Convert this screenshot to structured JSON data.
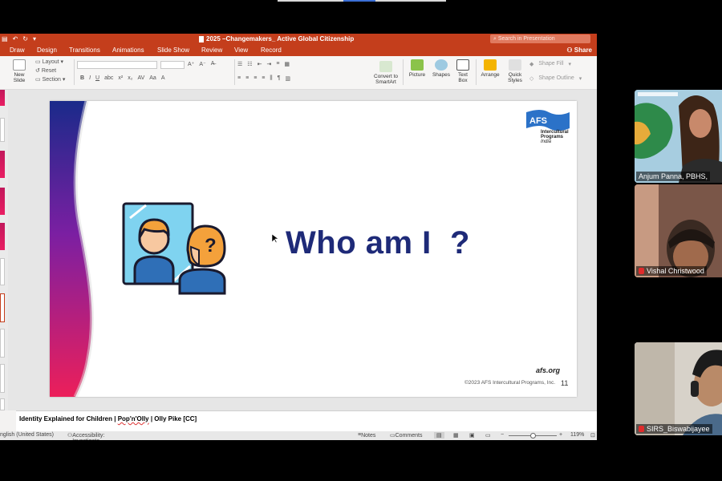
{
  "window": {
    "title": "2025 –Changemakers_ Active Global Citizenship",
    "search_placeholder": "Search in Presentation",
    "share_label": "Share"
  },
  "menu": [
    "Draw",
    "Design",
    "Transitions",
    "Animations",
    "Slide Show",
    "Review",
    "View",
    "Record"
  ],
  "ribbon": {
    "new_slide": "New Slide",
    "layout": "Layout",
    "reset": "Reset",
    "section": "Section",
    "convert": "Convert to SmartArt",
    "picture": "Picture",
    "shapes": "Shapes",
    "text_box": "Text Box",
    "arrange": "Arrange",
    "quick_styles": "Quick Styles",
    "shape_fill": "Shape Fill",
    "shape_outline": "Shape Outline"
  },
  "slide": {
    "heading": "Who am I  ?",
    "logo_brand": "AFS",
    "logo_sub": "Intercultural Programs",
    "logo_country": "India",
    "afs_org": "afs.org",
    "copyright": "©2023 AFS Intercultural Programs, Inc.",
    "number": "11"
  },
  "notes": {
    "text_before": "Identity Explained for Children | ",
    "text_underlined": "Pop'n'Olly",
    "text_after": " | Olly Pike [CC]"
  },
  "status": {
    "language": "nglish (United States)",
    "accessibility": "Accessibility: Investigate",
    "notes": "Notes",
    "comments": "Comments",
    "zoom": "119%"
  },
  "participants": [
    {
      "name": "Anjum Panna, PBHS,"
    },
    {
      "name": "Vishal Christwood"
    },
    {
      "name": "SIRS_Biswabijayee"
    }
  ],
  "colors": {
    "ppt_accent": "#c43e1c",
    "heading": "#1e2a78"
  }
}
